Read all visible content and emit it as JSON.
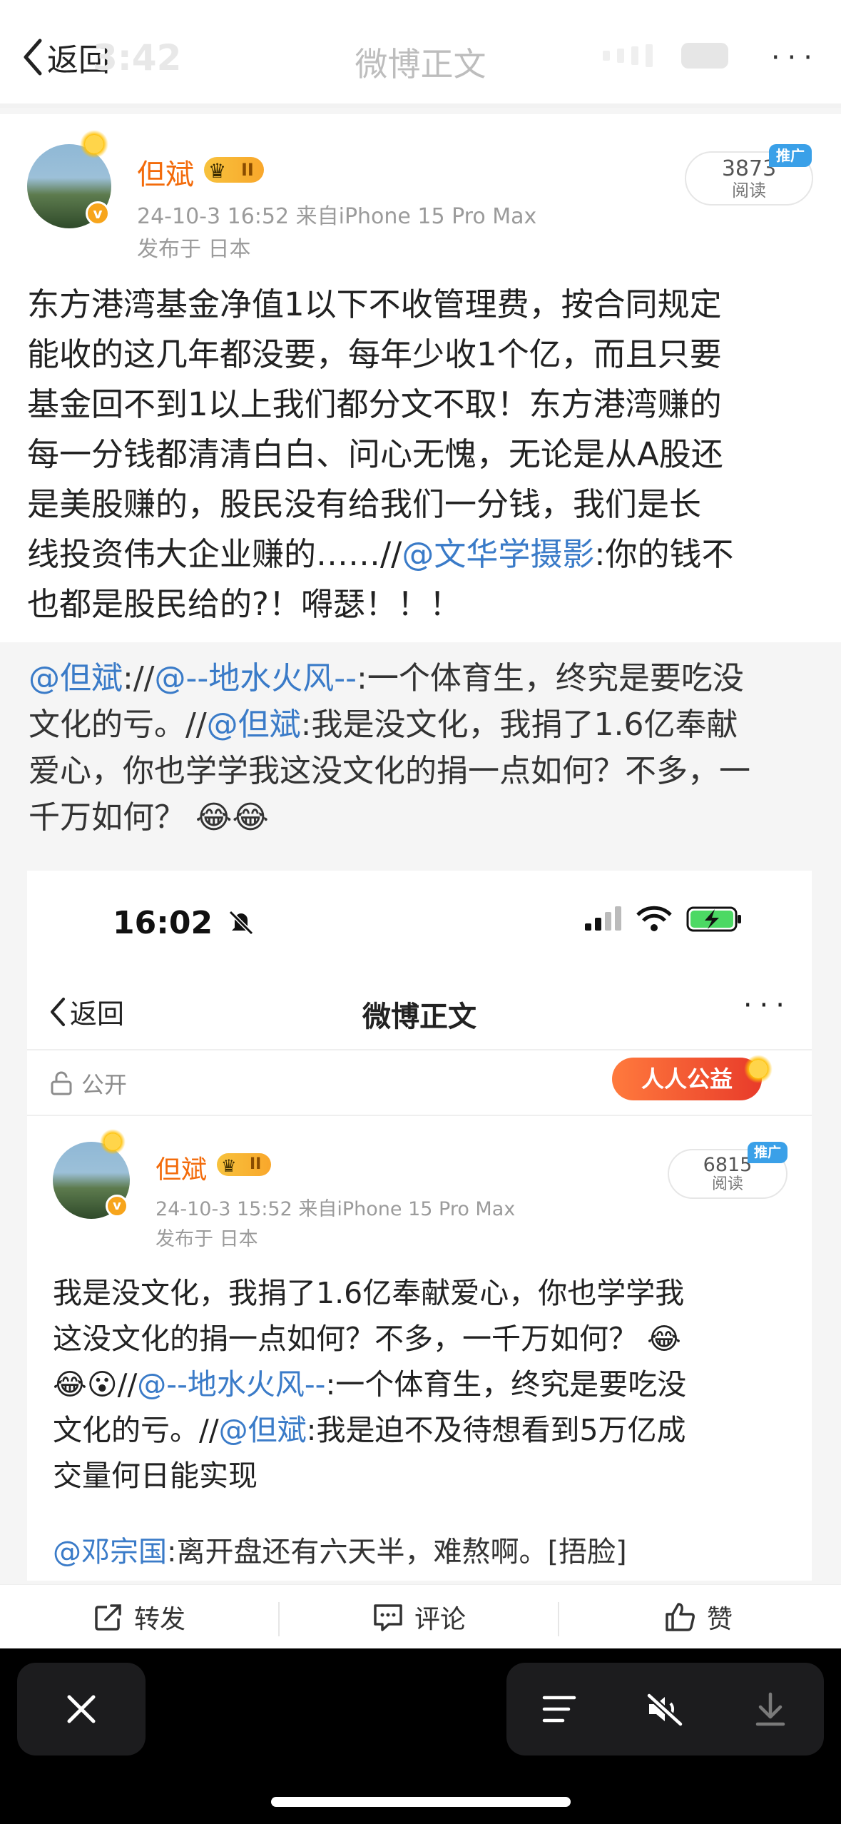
{
  "nav": {
    "back_label": "返回",
    "ghost_time": "3:42",
    "title": "微博正文",
    "more": "···"
  },
  "post": {
    "username": "但斌",
    "vip_level": "II",
    "timestamp_source": "24-10-3 16:52  来自iPhone 15 Pro Max",
    "location": "发布于 日本",
    "read_count": "3873",
    "read_label": "阅读",
    "promo_tag": "推广",
    "body_lines": [
      "东方港湾基金净值1以下不收管理费，按合同规定",
      "能收的这几年都没要，每年少收1个亿，而且只要",
      "基金回不到1以上我们都分文不取！东方港湾赚的",
      "每一分钱都清清白白、问心无愧，无论是从A股还",
      "是美股赚的，股民没有给我们一分钱，我们是长"
    ],
    "line6_pre": "线投资伟大企业赚的……//",
    "line6_mention": "@文华学摄影",
    "line6_post": ":你的钱不",
    "line7": "也都是股民给的?！嘚瑟！！！"
  },
  "repost": {
    "m1": "@但斌",
    "t1": "://",
    "m2": "@--地水火风--",
    "t2": ":一个体育生，终究是要吃没",
    "t3": "文化的亏。//",
    "m3": "@但斌",
    "t4": ":我是没文化，我捐了1.6亿奉献",
    "t5": "爱心，你也学学我这没文化的捐一点如何？不多，一",
    "t6": "千万如何？",
    "emoji": "😂😂"
  },
  "embed": {
    "time": "16:02",
    "back_label": "返回",
    "title": "微博正文",
    "more": "···",
    "public_label": "公开",
    "charity_label": "人人公益",
    "username": "但斌",
    "vip_level": "II",
    "timestamp_source": "24-10-3 15:52  来自iPhone 15 Pro Max",
    "location": "发布于 日本",
    "read_count": "6815",
    "read_label": "阅读",
    "promo_tag": "推广",
    "l1": "我是没文化，我捐了1.6亿奉献爱心，你也学学我",
    "l2": "这没文化的捐一点如何？不多，一千万如何？",
    "l2_emoji": "😂",
    "l3_emoji": "😂😮",
    "l3_pre": "//",
    "l3_mention": "@--地水火风--",
    "l3_post": ":一个体育生，终究是要吃没",
    "l4_pre": "文化的亏。//",
    "l4_mention": "@但斌",
    "l4_post": ":我是迫不及待想看到5万亿成",
    "l5": "交量何日能实现"
  },
  "comment": {
    "mention": "@邓宗国",
    "text": ":离开盘还有六天半，难熬啊。[捂脸]"
  },
  "actions": {
    "repost": "转发",
    "comment": "评论",
    "like": "赞"
  },
  "colors": {
    "accent_link": "#3a7bc8",
    "username_orange": "#f36b0b",
    "promo_blue": "#3aa0e8"
  }
}
